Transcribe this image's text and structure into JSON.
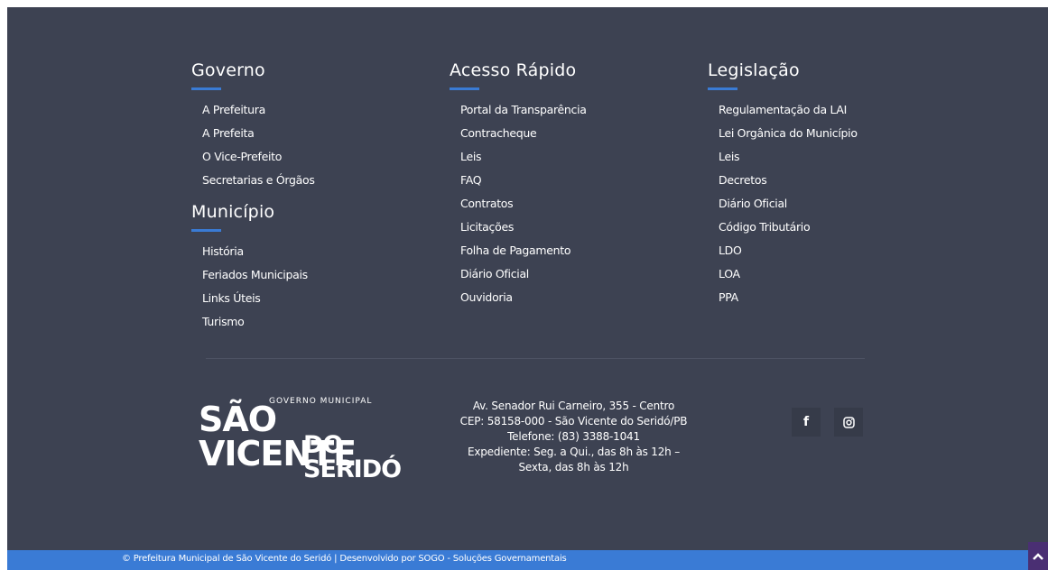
{
  "footer": {
    "columns": [
      {
        "title": "Governo",
        "links": [
          "A Prefeitura",
          "A Prefeita",
          "O Vice-Prefeito",
          "Secretarias e Órgãos"
        ]
      },
      {
        "title": "Município",
        "links": [
          "História",
          "Feriados Municipais",
          "Links Úteis",
          "Turismo"
        ]
      },
      {
        "title": "Acesso Rápido",
        "links": [
          "Portal da Transparência",
          "Contracheque",
          "Leis",
          "FAQ",
          "Contratos",
          "Licitações",
          "Folha de Pagamento",
          "Diário Oficial",
          "Ouvidoria"
        ]
      },
      {
        "title": "Legislação",
        "links": [
          "Regulamentação da LAI",
          "Lei Orgânica do Município",
          "Leis",
          "Decretos",
          "Diário Oficial",
          "Código Tributário",
          "LDO",
          "LOA",
          "PPA"
        ]
      }
    ],
    "logo": {
      "top_text": "GOVERNO MUNICIPAL",
      "line1": "SÃO VICENTE",
      "line2": "DO SERIDÓ"
    },
    "address": {
      "street": "Av. Senador Rui Carneiro, 355 - Centro",
      "cep": "CEP: 58158-000 - São Vicente do Seridó/PB",
      "phone": "Telefone: (83) 3388-1041",
      "hours": "Expediente: Seg. a Qui., das 8h às 12h – Sexta, das 8h às 12h"
    },
    "social": [
      "facebook-icon",
      "instagram-icon"
    ],
    "copyright": "© Prefeitura Municipal de São Vicente do Seridó | Desenvolvido por SOGO - Soluções Governamentais",
    "colors": {
      "background": "#3d4252",
      "accent": "#3a7bd5",
      "back_to_top": "#4a2f73"
    }
  }
}
